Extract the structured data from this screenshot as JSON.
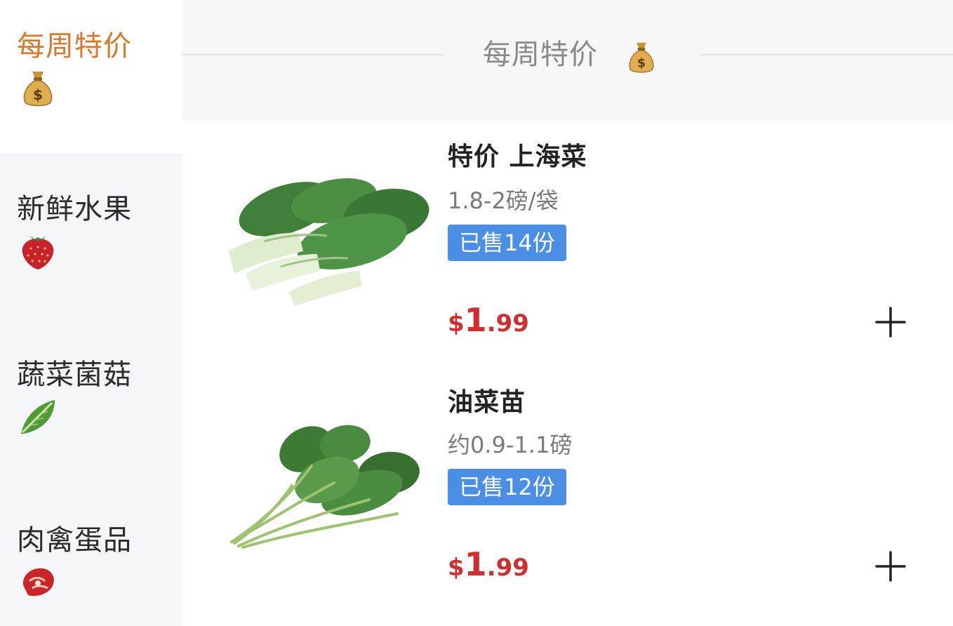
{
  "sidebar": {
    "items": [
      {
        "label": "每周特价",
        "icon": "money-bag-icon",
        "active": true
      },
      {
        "label": "新鲜水果",
        "icon": "strawberry-icon",
        "active": false
      },
      {
        "label": "蔬菜菌菇",
        "icon": "leafy-green-icon",
        "active": false
      },
      {
        "label": "肉禽蛋品",
        "icon": "meat-icon",
        "active": false
      }
    ]
  },
  "section": {
    "title": "每周特价",
    "icon": "money-bag-icon"
  },
  "products": [
    {
      "name": "特价 上海菜",
      "spec": "1.8-2磅/袋",
      "sold": "已售14份",
      "price_currency": "$",
      "price_int": "1",
      "price_dec": ".99",
      "image": "bok-choy-image"
    },
    {
      "name": "油菜苗",
      "spec": "约0.9-1.1磅",
      "sold": "已售12份",
      "price_currency": "$",
      "price_int": "1",
      "price_dec": ".99",
      "image": "rapeseed-greens-image"
    }
  ],
  "colors": {
    "accent_orange": "#d9782c",
    "price_red": "#d12f2f",
    "badge_blue": "#4a8ee6",
    "sidebar_bg": "#f4f6fa"
  }
}
